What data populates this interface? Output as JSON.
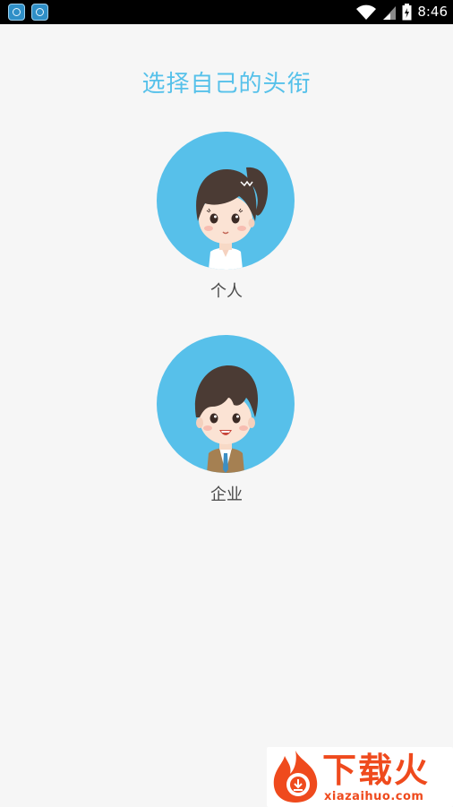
{
  "status_bar": {
    "time": "8:46",
    "app_icons": [
      "app-icon",
      "app-icon"
    ],
    "indicators": [
      "wifi-icon",
      "signal-icon",
      "battery-charging-icon"
    ]
  },
  "page": {
    "title": "选择自己的头衔"
  },
  "options": [
    {
      "label": "个人",
      "avatar": "girl-avatar"
    },
    {
      "label": "企业",
      "avatar": "businessman-avatar"
    }
  ],
  "watermark": {
    "title": "下载火",
    "url": "xiazaihuo.com"
  },
  "colors": {
    "accent": "#57c0ea",
    "title": "#56c1ea",
    "background": "#f6f6f6",
    "watermark": "#ef4a1d"
  }
}
